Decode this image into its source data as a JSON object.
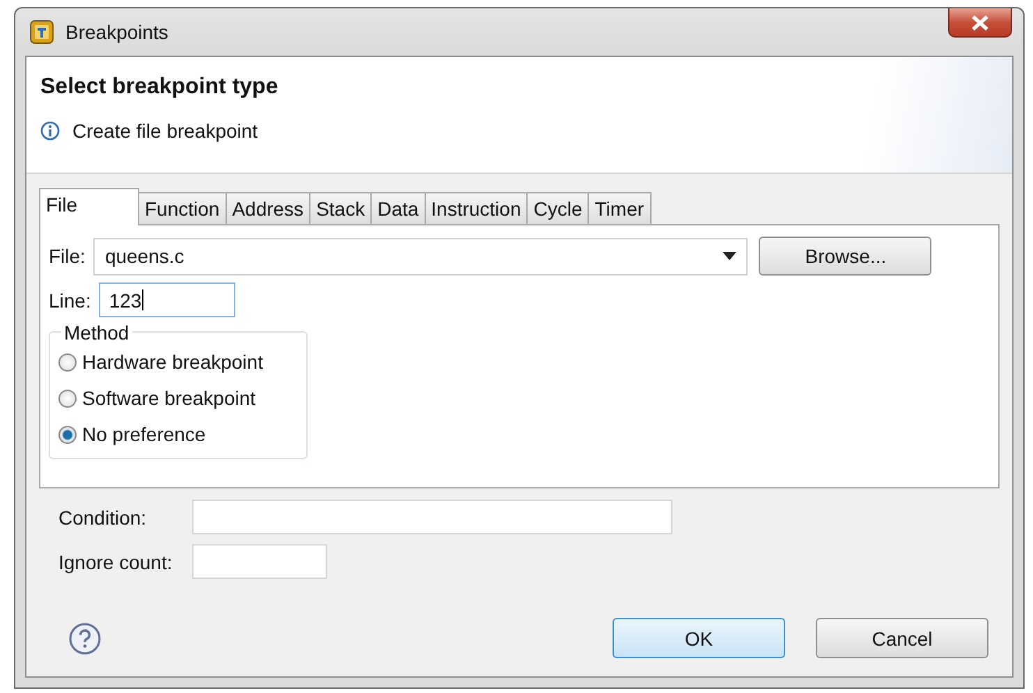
{
  "window": {
    "title": "Breakpoints"
  },
  "header": {
    "title": "Select breakpoint type",
    "message": "Create file breakpoint"
  },
  "tabs": [
    {
      "label": "File",
      "selected": true
    },
    {
      "label": "Function",
      "selected": false
    },
    {
      "label": "Address",
      "selected": false
    },
    {
      "label": "Stack",
      "selected": false
    },
    {
      "label": "Data",
      "selected": false
    },
    {
      "label": "Instruction",
      "selected": false
    },
    {
      "label": "Cycle",
      "selected": false
    },
    {
      "label": "Timer",
      "selected": false
    }
  ],
  "file_field": {
    "label": "File:",
    "value": "queens.c",
    "browse": "Browse..."
  },
  "line_field": {
    "label": "Line:",
    "value": "123"
  },
  "method": {
    "legend": "Method",
    "options": [
      {
        "label": "Hardware breakpoint",
        "selected": false
      },
      {
        "label": "Software breakpoint",
        "selected": false
      },
      {
        "label": "No preference",
        "selected": true
      }
    ]
  },
  "condition": {
    "label": "Condition:"
  },
  "ignore_count": {
    "label": "Ignore count:"
  },
  "buttons": [
    {
      "label": "OK",
      "default": true
    },
    {
      "label": "Cancel",
      "default": false
    }
  ]
}
